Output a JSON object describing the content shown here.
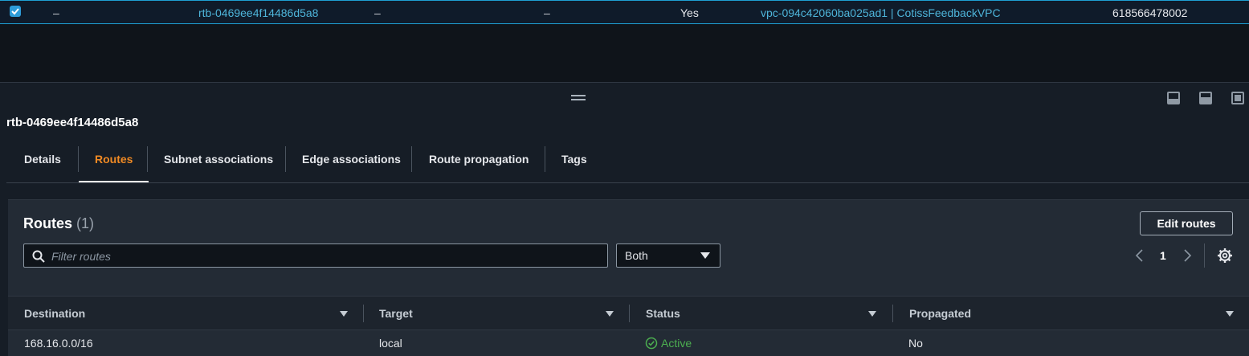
{
  "selected_row": {
    "checked": true,
    "col1": "–",
    "route_table_id": "rtb-0469ee4f14486d5a8",
    "col3": "–",
    "col4": "–",
    "main": "Yes",
    "vpc": "vpc-094c42060ba025ad1 | CotissFeedbackVPC",
    "owner_id": "618566478002"
  },
  "details": {
    "resource_id": "rtb-0469ee4f14486d5a8"
  },
  "tabs": [
    {
      "label": "Details",
      "active": false
    },
    {
      "label": "Routes",
      "active": true
    },
    {
      "label": "Subnet associations",
      "active": false
    },
    {
      "label": "Edge associations",
      "active": false
    },
    {
      "label": "Route propagation",
      "active": false
    },
    {
      "label": "Tags",
      "active": false
    }
  ],
  "routes": {
    "title": "Routes",
    "count": "(1)",
    "edit_button": "Edit routes",
    "filter_placeholder": "Filter routes",
    "select_value": "Both",
    "page": "1",
    "columns": [
      "Destination",
      "Target",
      "Status",
      "Propagated"
    ],
    "rows": [
      {
        "destination": "168.16.0.0/16",
        "target": "local",
        "status": "Active",
        "propagated": "No"
      }
    ]
  },
  "colors": {
    "accent": "#f08a24",
    "link": "#4eb4d9",
    "status_active": "#4caf50",
    "selection_border": "#1e9fd2"
  },
  "icons": [
    "checkbox-checked-icon",
    "drag-handle-icon",
    "panel-bottom-icon",
    "panel-split-icon",
    "panel-full-icon",
    "search-icon",
    "caret-down-icon",
    "chevron-left-icon",
    "chevron-right-icon",
    "gear-icon",
    "sort-caret-icon",
    "check-circle-icon"
  ]
}
